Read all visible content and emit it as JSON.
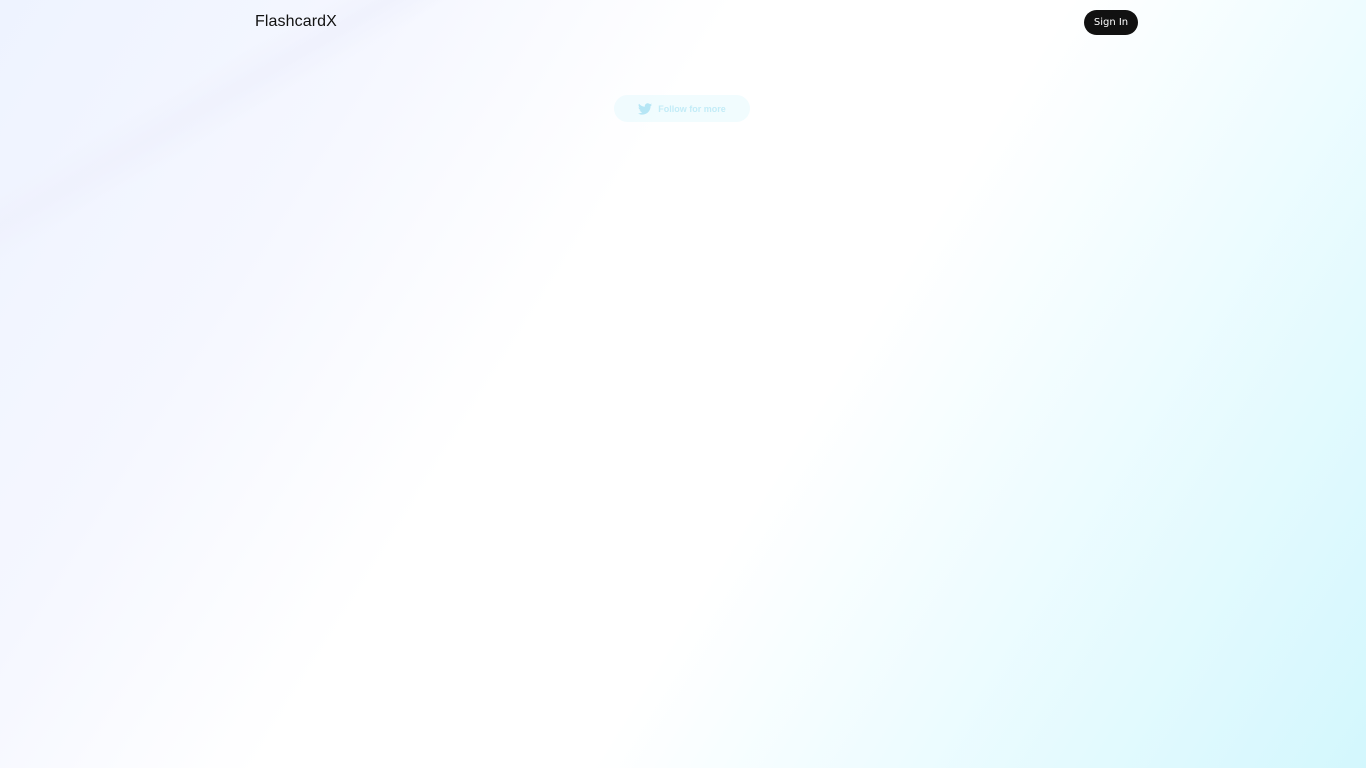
{
  "header": {
    "logo": "FlashcardX",
    "signin_label": "Sign In"
  },
  "hero": {
    "follow_label": "Follow for more",
    "follow_icon": "twitter-icon"
  },
  "faded": {
    "text_1": "",
    "text_2": "",
    "text_3": ""
  },
  "colors": {
    "button_bg": "#111111",
    "accent": "#6ecdeb"
  }
}
